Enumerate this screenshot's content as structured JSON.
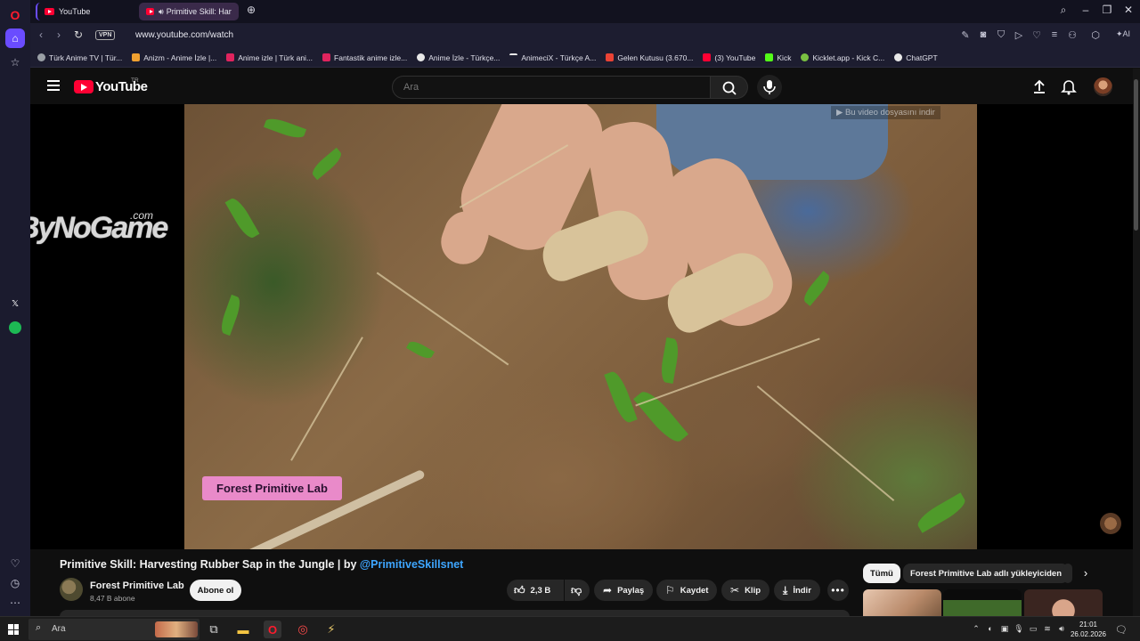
{
  "browser": {
    "tabs": [
      {
        "label": "YouTube",
        "active": false
      },
      {
        "label": "Primitive Skill: Harvest",
        "active": true
      }
    ],
    "new_tab_icon": "plus-icon",
    "url": "www.youtube.com/watch",
    "vpn_label": "VPN",
    "bookmarks": [
      {
        "label": "Türk Anime TV | Tür...",
        "color": "#9aa0a6"
      },
      {
        "label": "Anizm - Anime İzle |...",
        "color": "#f0a030"
      },
      {
        "label": "Anime izle | Türk ani...",
        "color": "#e0245e"
      },
      {
        "label": "Fantastik anime izle...",
        "color": "#e0245e"
      },
      {
        "label": "Anime İzle - Türkçe...",
        "color": "#e8e8e8"
      },
      {
        "label": "AnimeciX - Türkçe A...",
        "color": "#e8e8e8"
      },
      {
        "label": "Gelen Kutusu (3.670...",
        "color": "#ea4335"
      },
      {
        "label": "(3) YouTube",
        "color": "#ff0033"
      },
      {
        "label": "Kick",
        "color": "#53fc18"
      },
      {
        "label": "Kicklet.app - Kick C...",
        "color": "#7ac142"
      },
      {
        "label": "ChatGPT",
        "color": "#e8e8e8"
      }
    ]
  },
  "youtube": {
    "logo_text": "YouTube",
    "region": "TR",
    "search_placeholder": "Ara",
    "video_overlay_text": "Forest Primitive Lab",
    "download_overlay_text": "▶ Bu video dosyasını indir",
    "side_watermark": "ByNoGame",
    "side_watermark_suffix": ".com",
    "video_title_main": "Primitive Skill: Harvesting Rubber Sap in the Jungle | by ",
    "video_title_tag": "@PrimitiveSkillsnet",
    "channel_name": "Forest Primitive Lab",
    "channel_subs": "8,47 B abone",
    "subscribe_label": "Abone ol",
    "like_count": "2,3 B",
    "share_label": "Paylaş",
    "save_label": "Kaydet",
    "clip_label": "Klip",
    "download_label": "İndir",
    "chips": [
      {
        "label": "Tümü",
        "active": true
      },
      {
        "label": "Forest Primitive Lab adlı yükleyiciden",
        "active": false
      }
    ]
  },
  "taskbar": {
    "search_text": "Ara",
    "time": "21:01",
    "date": "26.02.2026"
  },
  "colors": {
    "accent_red": "#ff0033",
    "link_blue": "#3ea6ff",
    "opera_red": "#ff1b2d"
  }
}
